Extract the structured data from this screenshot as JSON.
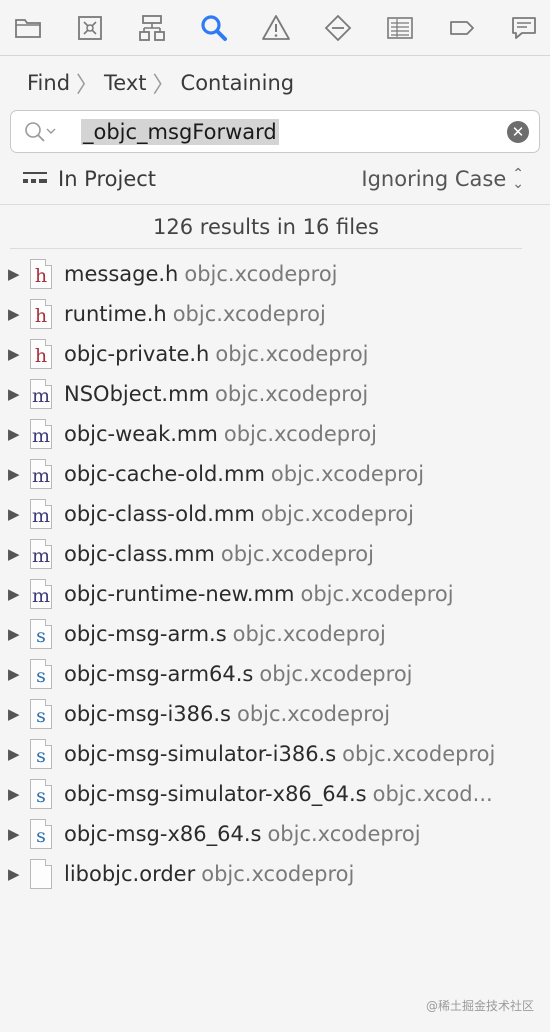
{
  "toolbar": {
    "icons": [
      "project-navigator-icon",
      "source-control-icon",
      "symbol-navigator-icon",
      "find-navigator-icon",
      "issue-navigator-icon",
      "test-navigator-icon",
      "debug-navigator-icon",
      "breakpoint-navigator-icon",
      "report-navigator-icon"
    ],
    "active_color": "#2f7bf5"
  },
  "breadcrumb": {
    "find": "Find",
    "text": "Text",
    "containing": "Containing"
  },
  "search": {
    "value": "_objc_msgForward"
  },
  "scope": {
    "left": "In Project",
    "right": "Ignoring Case"
  },
  "summary": "126 results in 16 files",
  "files": [
    {
      "name": "message.h",
      "project": "objc.xcodeproj",
      "type": "h",
      "color": "#a8323a"
    },
    {
      "name": "runtime.h",
      "project": "objc.xcodeproj",
      "type": "h",
      "color": "#a8323a"
    },
    {
      "name": "objc-private.h",
      "project": "objc.xcodeproj",
      "type": "h",
      "color": "#a8323a"
    },
    {
      "name": "NSObject.mm",
      "project": "objc.xcodeproj",
      "type": "m",
      "color": "#3d3a78"
    },
    {
      "name": "objc-weak.mm",
      "project": "objc.xcodeproj",
      "type": "m",
      "color": "#3d3a78"
    },
    {
      "name": "objc-cache-old.mm",
      "project": "objc.xcodeproj",
      "type": "m",
      "color": "#3d3a78"
    },
    {
      "name": "objc-class-old.mm",
      "project": "objc.xcodeproj",
      "type": "m",
      "color": "#3d3a78"
    },
    {
      "name": "objc-class.mm",
      "project": "objc.xcodeproj",
      "type": "m",
      "color": "#3d3a78"
    },
    {
      "name": "objc-runtime-new.mm",
      "project": "objc.xcodeproj",
      "type": "m",
      "color": "#3d3a78"
    },
    {
      "name": "objc-msg-arm.s",
      "project": "objc.xcodeproj",
      "type": "s",
      "color": "#2b6fae"
    },
    {
      "name": "objc-msg-arm64.s",
      "project": "objc.xcodeproj",
      "type": "s",
      "color": "#2b6fae"
    },
    {
      "name": "objc-msg-i386.s",
      "project": "objc.xcodeproj",
      "type": "s",
      "color": "#2b6fae"
    },
    {
      "name": "objc-msg-simulator-i386.s",
      "project": "objc.xcodeproj",
      "type": "s",
      "color": "#2b6fae"
    },
    {
      "name": "objc-msg-simulator-x86_64.s",
      "project": "objc.xcod...",
      "type": "s",
      "color": "#2b6fae"
    },
    {
      "name": "objc-msg-x86_64.s",
      "project": "objc.xcodeproj",
      "type": "s",
      "color": "#2b6fae"
    },
    {
      "name": "libobjc.order",
      "project": "objc.xcodeproj",
      "type": "",
      "color": "#888888"
    }
  ],
  "watermark": "@稀土掘金技术社区"
}
